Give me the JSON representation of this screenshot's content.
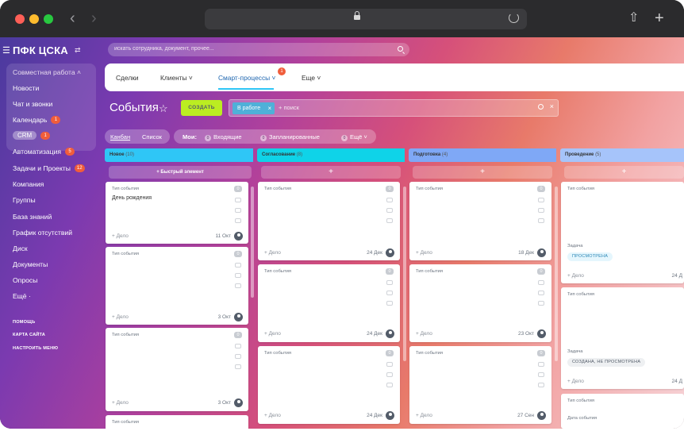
{
  "browser": {
    "nav_back": "‹",
    "nav_forward": "›",
    "share": "⇧",
    "new_tab": "+"
  },
  "sidebar": {
    "title": "ПФК ЦСКА",
    "group_label": "Совместная работа ˄",
    "items": [
      {
        "label": "Новости"
      },
      {
        "label": "Чат и звонки"
      },
      {
        "label": "Календарь",
        "badge": "1"
      },
      {
        "label": "CRM",
        "badge": "1"
      },
      {
        "label": "Автоматизация",
        "badge": "5"
      },
      {
        "label": "Задачи и Проекты",
        "badge": "12"
      },
      {
        "label": "Компания"
      },
      {
        "label": "Группы"
      },
      {
        "label": "База знаний"
      },
      {
        "label": "График отсутствий"
      },
      {
        "label": "Диск"
      },
      {
        "label": "Документы"
      },
      {
        "label": "Опросы"
      },
      {
        "label": "Ещё ·"
      }
    ],
    "links": [
      "ПОМОЩЬ",
      "КАРТА САЙТА",
      "НАСТРОИТЬ МЕНЮ"
    ]
  },
  "search": {
    "placeholder": "искать сотрудника, документ, прочее..."
  },
  "topnav": {
    "tabs": [
      {
        "label": "Сделки"
      },
      {
        "label": "Клиенты ˅"
      },
      {
        "label": "Смарт-процессы ˅",
        "badge": "1"
      },
      {
        "label": "Еще ˅"
      }
    ]
  },
  "page": {
    "title": "События",
    "create_label": "СОЗДАТЬ"
  },
  "filter": {
    "chip": "В работе",
    "chip_remove": "×",
    "placeholder": "+ поиск",
    "clear": "×"
  },
  "view": {
    "kanban": "Канбан",
    "list": "Список",
    "my_label": "Мои:",
    "incoming": "Входящие",
    "incoming_count": "0",
    "planned": "Запланированные",
    "planned_count": "0",
    "more": "Ещё ˅",
    "more_count": "0"
  },
  "colors": {
    "new": "#2fc6f6",
    "approval": "#0fd3e8",
    "prep": "#7fa8f6",
    "run": "#8ab4f8",
    "create_btn": "#bbed21",
    "badge": "#f05d3b"
  },
  "columns": [
    {
      "title": "Новое",
      "count": "(10)",
      "quick_add": "+ Быстрый элемент",
      "cards": [
        {
          "type": "Тип события",
          "name": "День рождения",
          "count": "0",
          "add": "+ Дело",
          "date": "11 Окт"
        },
        {
          "type": "Тип события",
          "count": "0",
          "add": "+ Дело",
          "date": "3 Окт"
        },
        {
          "type": "Тип события",
          "count": "0",
          "add": "+ Дело",
          "date": "3 Окт"
        },
        {
          "type": "Тип события"
        }
      ]
    },
    {
      "title": "Согласование",
      "count": "(8)",
      "plus": "+",
      "cards": [
        {
          "type": "Тип события",
          "count": "0",
          "add": "+ Дело",
          "date": "24 Дек"
        },
        {
          "type": "Тип события",
          "count": "0",
          "add": "+ Дело",
          "date": "24 Дек"
        },
        {
          "type": "Тип события",
          "count": "0",
          "add": "+ Дело",
          "date": "24 Дек"
        }
      ]
    },
    {
      "title": "Подготовка",
      "count": "(4)",
      "plus": "+",
      "cards": [
        {
          "type": "Тип события",
          "count": "0",
          "add": "+ Дело",
          "date": "18 Дек"
        },
        {
          "type": "Тип события",
          "count": "0",
          "add": "+ Дело",
          "date": "23 Окт"
        },
        {
          "type": "Тип события",
          "count": "0",
          "add": "+ Дело",
          "date": "27 Сен"
        }
      ]
    },
    {
      "title": "Проведение",
      "count": "(5)",
      "plus": "+",
      "cards": [
        {
          "type": "Тип события",
          "task_label": "Задача",
          "status": "ПРОСМОТРЕНА",
          "add": "+ Дело",
          "date": "24 Д"
        },
        {
          "type": "Тип события",
          "task_label": "Задача",
          "status": "СОЗДАНА, НЕ ПРОСМОТРЕНА",
          "add": "+ Дело",
          "date": "24 Д"
        },
        {
          "type": "Тип события",
          "date_label": "Дата события"
        }
      ]
    }
  ]
}
